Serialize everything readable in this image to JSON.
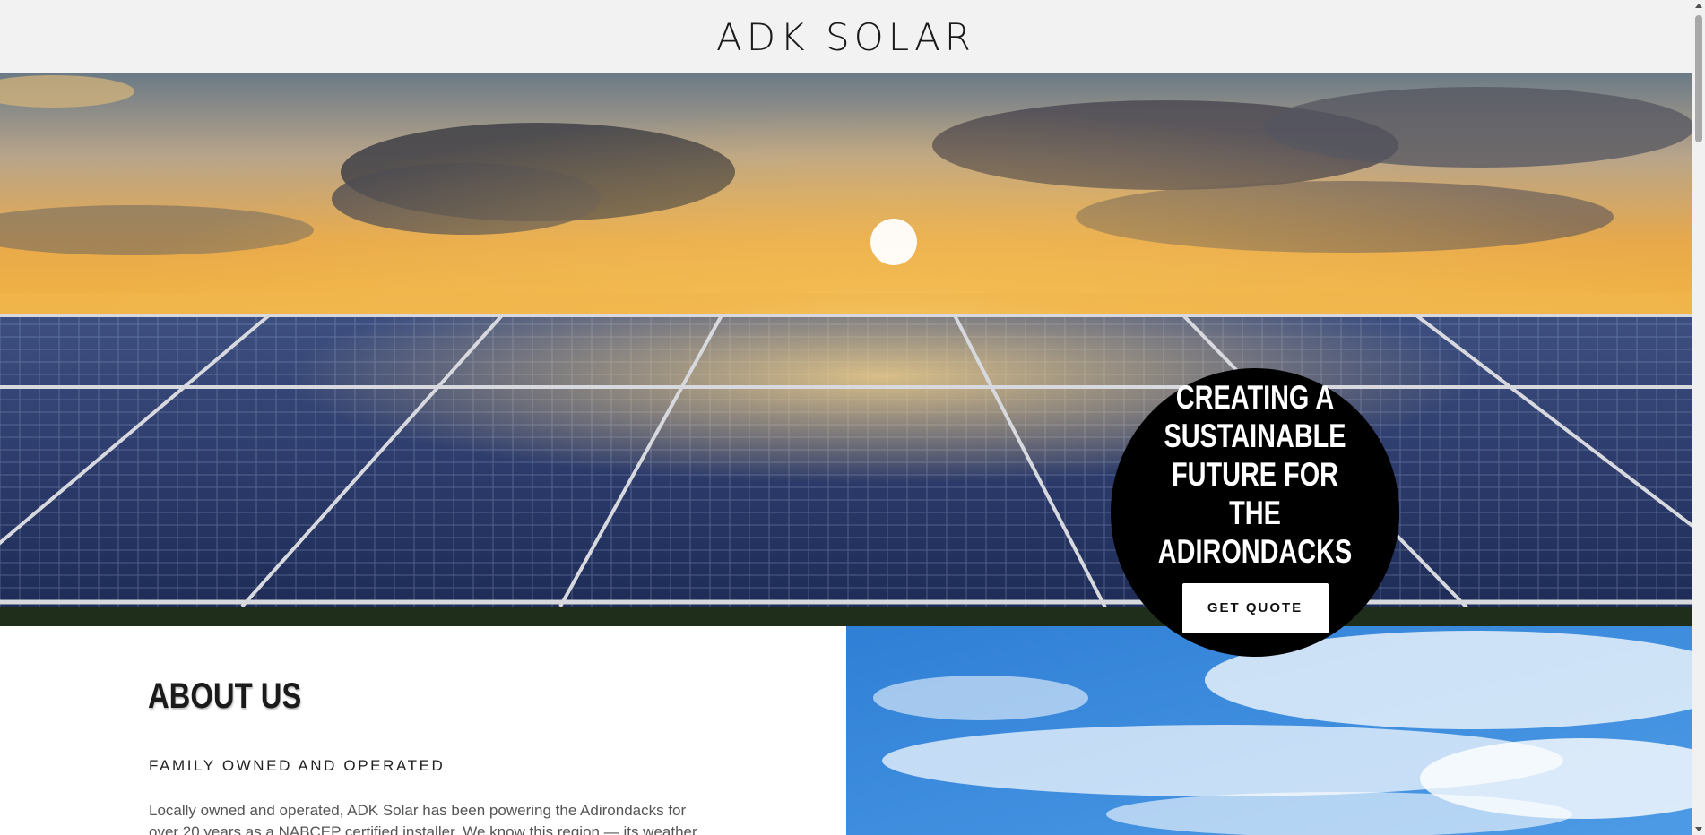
{
  "header": {
    "brand": "ADK SOLAR"
  },
  "hero": {
    "image": "solar-panels-at-sunset",
    "badge_title": "CREATING A SUSTAINABLE FUTURE FOR THE ADIRONDACKS",
    "cta_label": "GET QUOTE"
  },
  "about": {
    "heading": "ABOUT US",
    "subheading": "FAMILY OWNED AND OPERATED",
    "body": " Locally owned and operated, ADK Solar has been powering the Adirondacks for over 20 years as a NABCEP certified installer. We know this region — its weather, its"
  },
  "sky_image": "blue-sky-with-clouds",
  "colors": {
    "header_bg": "#f2f2f2",
    "badge_bg": "#000000",
    "button_bg": "#ffffff",
    "text_dark": "#1a1a1a",
    "text_body": "#555555"
  }
}
